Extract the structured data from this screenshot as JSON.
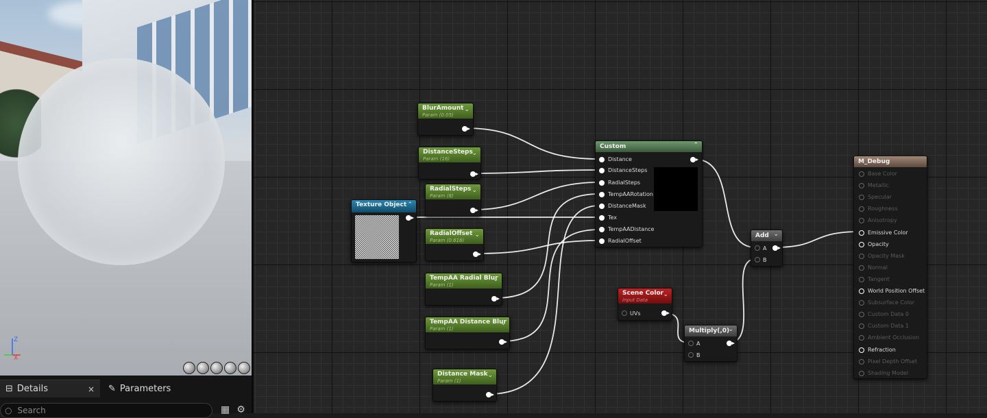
{
  "viewport": {
    "axis_z": "Z",
    "axis_x": "X",
    "axis_y": "Y"
  },
  "panel": {
    "tabs": [
      {
        "label": "Details",
        "close": "×"
      },
      {
        "label": "Parameters"
      }
    ],
    "search_placeholder": "Search"
  },
  "graph": {
    "params": [
      {
        "title": "BlurAmount",
        "subtitle": "Param (0.05)"
      },
      {
        "title": "DistanceSteps",
        "subtitle": "Param (16)"
      },
      {
        "title": "RadialSteps",
        "subtitle": "Param (8)"
      },
      {
        "title": "RadialOffset",
        "subtitle": "Param (0.618)"
      },
      {
        "title": "TempAA Radial Blur",
        "subtitle": "Param (1)"
      },
      {
        "title": "TempAA Distance Blur",
        "subtitle": "Param (1)"
      },
      {
        "title": "Distance Mask",
        "subtitle": "Param (1)"
      }
    ],
    "texture_object": {
      "title": "Texture Object"
    },
    "custom": {
      "title": "Custom",
      "inputs": [
        "Distance",
        "DistanceSteps",
        "RadialSteps",
        "TempAARotation",
        "DistanceMask",
        "Tex",
        "TempAADistance",
        "RadialOffset"
      ]
    },
    "scene_color": {
      "title": "Scene Color",
      "subtitle": "Input Data",
      "pin": "UVs"
    },
    "multiply": {
      "title": "Multiply(,0)",
      "pins": [
        "A",
        "B"
      ]
    },
    "add": {
      "title": "Add",
      "pins": [
        "A",
        "B"
      ]
    },
    "material": {
      "title": "M_Debug",
      "pins": [
        {
          "label": "Base Color",
          "active": false
        },
        {
          "label": "Metallic",
          "active": false
        },
        {
          "label": "Specular",
          "active": false
        },
        {
          "label": "Roughness",
          "active": false
        },
        {
          "label": "Anisotropy",
          "active": false
        },
        {
          "label": "Emissive Color",
          "active": true
        },
        {
          "label": "Opacity",
          "active": true
        },
        {
          "label": "Opacity Mask",
          "active": false
        },
        {
          "label": "Normal",
          "active": false
        },
        {
          "label": "Tangent",
          "active": false
        },
        {
          "label": "World Position Offset",
          "active": true
        },
        {
          "label": "Subsurface Color",
          "active": false
        },
        {
          "label": "Custom Data 0",
          "active": false
        },
        {
          "label": "Custom Data 1",
          "active": false
        },
        {
          "label": "Ambient Occlusion",
          "active": false
        },
        {
          "label": "Refraction",
          "active": true
        },
        {
          "label": "Pixel Depth Offset",
          "active": false
        },
        {
          "label": "Shading Model",
          "active": false
        }
      ]
    }
  },
  "colors": {
    "param_header": "#5a8a2e",
    "texture_header": "#1e6a8e",
    "custom_header": "#4f7a4f",
    "scene_color_header": "#9a1a1a",
    "material_header": "#8a7060",
    "wire": "#ffffff"
  }
}
